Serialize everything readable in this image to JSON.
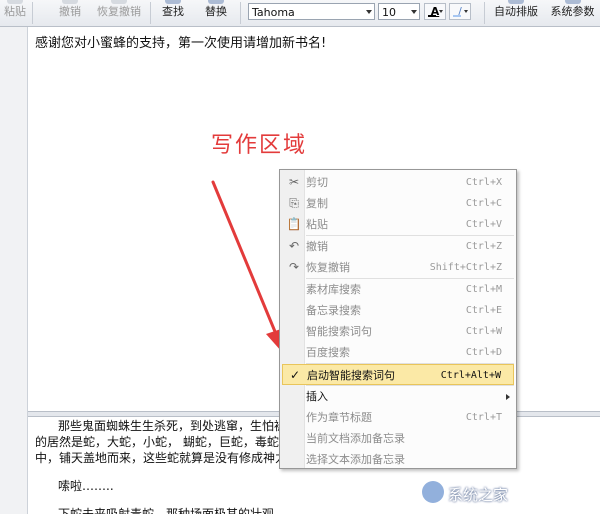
{
  "toolbar": {
    "paste_label": "粘贴",
    "undo_label": "撤销",
    "redo_label": "恢复撤销",
    "find_label": "查找",
    "replace_label": "替换",
    "font_name": "Tahoma",
    "font_size": "10",
    "font_color_glyph": "A",
    "highlight_glyph": "/",
    "auto_format_label": "自动排版",
    "settings_label": "系统参数",
    "font_color_hex": "#000000",
    "highlight_color_hex": "#a7c7f2"
  },
  "editor": {
    "first_line": "感谢您对小蜜蜂的支持，第一次使用请增加新书名!"
  },
  "annotation": {
    "text": "写作区域",
    "color": "#e33b3b"
  },
  "lower_text": {
    "line1": "那些鬼面蜘蛛生生杀死，到处逃窜，生怕被                                                 处逃窜，奈何看不",
    "line2": "的居然是蛇，大蛇，小蛇，     蝴蛇，巨蛇，毒蛇，                                        抗外面的山野之",
    "line3": "中，铺天盖地而来，这些蛇就算是没有修成神力",
    "line4": "嗦啦……..",
    "line5": "下蛇未来吸射毒蛇，那种场面极其的壮观"
  },
  "context_menu": {
    "items": [
      {
        "icon": "scissors-icon",
        "glyph": "✂",
        "label": "剪切",
        "shortcut": "Ctrl+X",
        "enabled": false
      },
      {
        "icon": "copy-icon",
        "glyph": "⎘",
        "label": "复制",
        "shortcut": "Ctrl+C",
        "enabled": false
      },
      {
        "icon": "clipboard-icon",
        "glyph": "📋",
        "label": "粘贴",
        "shortcut": "Ctrl+V",
        "enabled": false
      },
      {
        "icon": "undo-icon",
        "glyph": "↶",
        "label": "撤销",
        "shortcut": "Ctrl+Z",
        "enabled": false
      },
      {
        "icon": "redo-icon",
        "glyph": "↷",
        "label": "恢复撤销",
        "shortcut": "Shift+Ctrl+Z",
        "enabled": false
      },
      {
        "icon": "",
        "glyph": "",
        "label": "素材库搜索",
        "shortcut": "Ctrl+M",
        "enabled": false
      },
      {
        "icon": "",
        "glyph": "",
        "label": "备忘录搜索",
        "shortcut": "Ctrl+E",
        "enabled": false
      },
      {
        "icon": "",
        "glyph": "",
        "label": "智能搜索词句",
        "shortcut": "Ctrl+W",
        "enabled": false
      },
      {
        "icon": "",
        "glyph": "",
        "label": "百度搜索",
        "shortcut": "Ctrl+D",
        "enabled": false
      },
      {
        "icon": "check-icon",
        "glyph": "✓",
        "label": "启动智能搜索词句",
        "shortcut": "Ctrl+Alt+W",
        "enabled": true,
        "highlight": true
      },
      {
        "icon": "",
        "glyph": "",
        "label": "插入",
        "shortcut": "",
        "enabled": true,
        "submenu": true
      },
      {
        "icon": "",
        "glyph": "",
        "label": "作为章节标题",
        "shortcut": "Ctrl+T",
        "enabled": false
      },
      {
        "icon": "",
        "glyph": "",
        "label": "当前文档添加备忘录",
        "shortcut": "",
        "enabled": false
      },
      {
        "icon": "",
        "glyph": "",
        "label": "选择文本添加备忘录",
        "shortcut": "",
        "enabled": false
      }
    ]
  },
  "watermark": {
    "text": "系统之家"
  }
}
